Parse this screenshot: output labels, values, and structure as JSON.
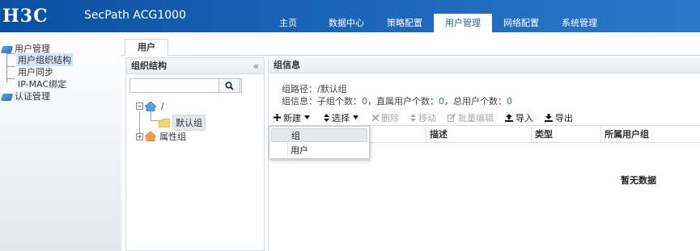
{
  "header": {
    "logo": "H3C",
    "product": "SecPath ACG1000",
    "nav": [
      {
        "label": "主页",
        "active": false
      },
      {
        "label": "数据中心",
        "active": false
      },
      {
        "label": "策略配置",
        "active": false
      },
      {
        "label": "用户管理",
        "active": true
      },
      {
        "label": "网络配置",
        "active": false
      },
      {
        "label": "系统管理",
        "active": false
      }
    ]
  },
  "sidebar": {
    "group1": "用户管理",
    "items": [
      "用户组织结构",
      "用户同步",
      "IP-MAC绑定"
    ],
    "group2": "认证管理"
  },
  "tab": {
    "label": "用户"
  },
  "left_panel": {
    "title": "组织结构",
    "collapse_glyph": "«",
    "search": {
      "value": "",
      "placeholder": ""
    },
    "tree": {
      "root": "/",
      "default_group": "默认组",
      "attr_group": "属性组"
    }
  },
  "right_panel": {
    "title": "组信息",
    "path_label": "组路径：",
    "path_value": "/默认组",
    "info_label": "组信息：",
    "subgroup_label": "子组个数：",
    "subgroup_count": "0",
    "direct_label": "，直属用户个数：",
    "direct_count": "0",
    "total_label": "，总用户个数：",
    "total_count": "0",
    "toolbar": {
      "new": "新建",
      "select": "选择",
      "delete": "删除",
      "move": "移动",
      "batch_edit": "批量编辑",
      "import": "导入",
      "export": "导出"
    },
    "columns": [
      "描述",
      "类型",
      "所属用户组"
    ],
    "empty": "暂无数据"
  },
  "dropdown": {
    "items": [
      "组",
      "用户"
    ]
  },
  "colors": {
    "header": "#1a63b8",
    "accent": "#1f6fc6"
  }
}
